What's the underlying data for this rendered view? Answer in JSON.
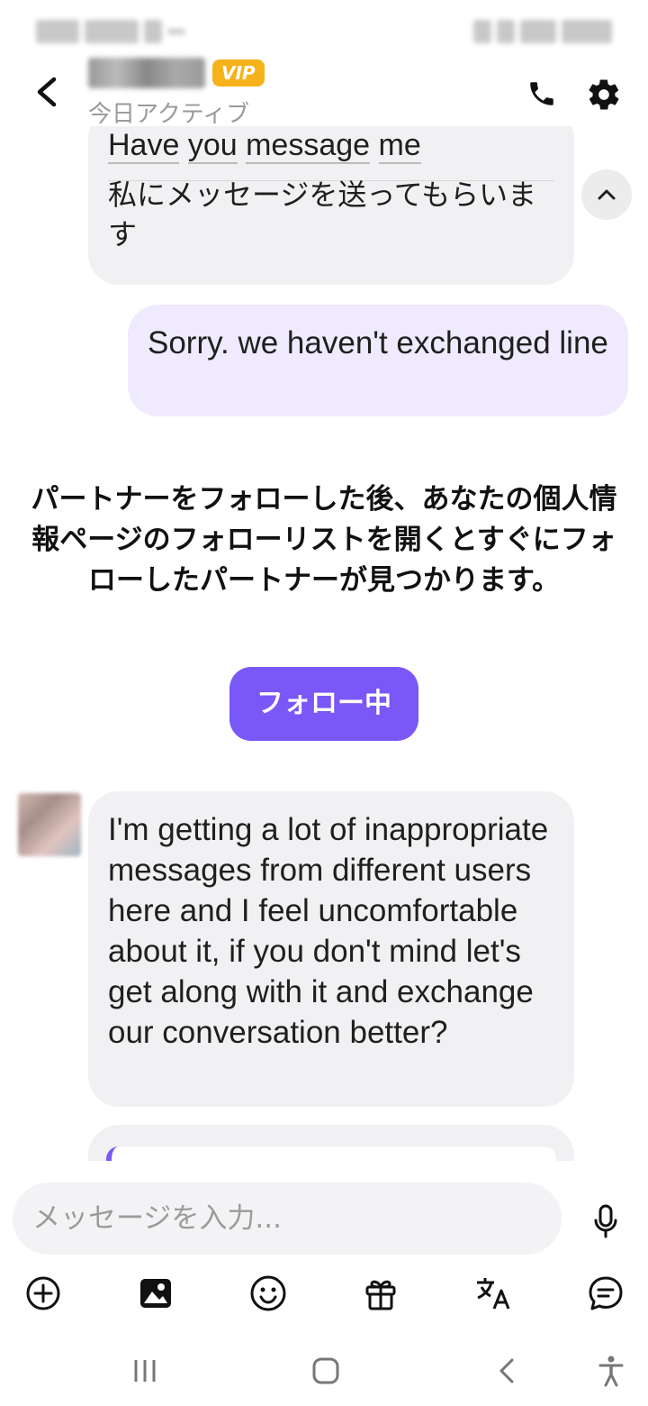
{
  "header": {
    "vip_label": "VIP",
    "active_status": "今日アクティブ"
  },
  "messages": {
    "incoming_translated": {
      "original_words": [
        "Have",
        "you",
        "message",
        "me"
      ],
      "translation": "私にメッセージを送ってもらいます"
    },
    "outgoing": {
      "text": "Sorry. we haven't exchanged line"
    },
    "incoming": {
      "text": "I'm getting a lot of inappropriate messages from different users here and I feel uncomfortable about it, if you don't mind let's get along with it and exchange our conversation better?"
    }
  },
  "system": {
    "note": "パートナーをフォローした後、あなたの個人情報ページのフォローリストを開くとすぐにフォローしたパートナーが見つかります。",
    "follow_button": "フォロー中"
  },
  "composer": {
    "placeholder": "メッセージを入力..."
  },
  "colors": {
    "accent": "#7a57f7",
    "outgoing_bubble": "#efeafd",
    "incoming_bubble": "#f1f1f3",
    "vip": "#f6b21a"
  },
  "icons": {
    "header": [
      "back-arrow-icon",
      "phone-icon",
      "gear-icon"
    ],
    "toolbar": [
      "plus-circle-icon",
      "image-icon",
      "emoji-icon",
      "gift-icon",
      "translate-icon",
      "chat-bubble-icon"
    ],
    "nav": [
      "recents-icon",
      "home-icon",
      "back-icon",
      "accessibility-icon"
    ]
  }
}
